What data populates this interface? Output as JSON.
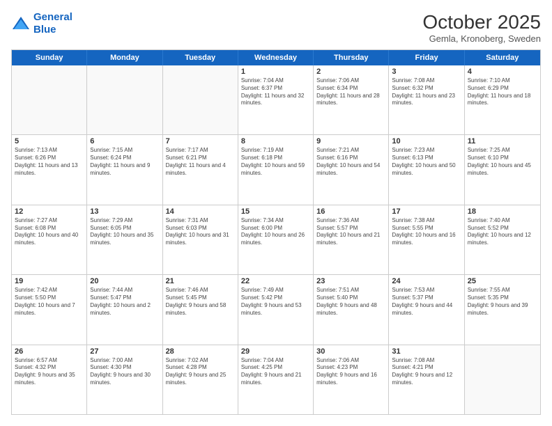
{
  "header": {
    "logo_line1": "General",
    "logo_line2": "Blue",
    "month": "October 2025",
    "location": "Gemla, Kronoberg, Sweden"
  },
  "days_of_week": [
    "Sunday",
    "Monday",
    "Tuesday",
    "Wednesday",
    "Thursday",
    "Friday",
    "Saturday"
  ],
  "weeks": [
    [
      {
        "day": "",
        "empty": true
      },
      {
        "day": "",
        "empty": true
      },
      {
        "day": "",
        "empty": true
      },
      {
        "day": "1",
        "sunrise": "7:04 AM",
        "sunset": "6:37 PM",
        "daylight": "11 hours and 32 minutes."
      },
      {
        "day": "2",
        "sunrise": "7:06 AM",
        "sunset": "6:34 PM",
        "daylight": "11 hours and 28 minutes."
      },
      {
        "day": "3",
        "sunrise": "7:08 AM",
        "sunset": "6:32 PM",
        "daylight": "11 hours and 23 minutes."
      },
      {
        "day": "4",
        "sunrise": "7:10 AM",
        "sunset": "6:29 PM",
        "daylight": "11 hours and 18 minutes."
      }
    ],
    [
      {
        "day": "5",
        "sunrise": "7:13 AM",
        "sunset": "6:26 PM",
        "daylight": "11 hours and 13 minutes."
      },
      {
        "day": "6",
        "sunrise": "7:15 AM",
        "sunset": "6:24 PM",
        "daylight": "11 hours and 9 minutes."
      },
      {
        "day": "7",
        "sunrise": "7:17 AM",
        "sunset": "6:21 PM",
        "daylight": "11 hours and 4 minutes."
      },
      {
        "day": "8",
        "sunrise": "7:19 AM",
        "sunset": "6:18 PM",
        "daylight": "10 hours and 59 minutes."
      },
      {
        "day": "9",
        "sunrise": "7:21 AM",
        "sunset": "6:16 PM",
        "daylight": "10 hours and 54 minutes."
      },
      {
        "day": "10",
        "sunrise": "7:23 AM",
        "sunset": "6:13 PM",
        "daylight": "10 hours and 50 minutes."
      },
      {
        "day": "11",
        "sunrise": "7:25 AM",
        "sunset": "6:10 PM",
        "daylight": "10 hours and 45 minutes."
      }
    ],
    [
      {
        "day": "12",
        "sunrise": "7:27 AM",
        "sunset": "6:08 PM",
        "daylight": "10 hours and 40 minutes."
      },
      {
        "day": "13",
        "sunrise": "7:29 AM",
        "sunset": "6:05 PM",
        "daylight": "10 hours and 35 minutes."
      },
      {
        "day": "14",
        "sunrise": "7:31 AM",
        "sunset": "6:03 PM",
        "daylight": "10 hours and 31 minutes."
      },
      {
        "day": "15",
        "sunrise": "7:34 AM",
        "sunset": "6:00 PM",
        "daylight": "10 hours and 26 minutes."
      },
      {
        "day": "16",
        "sunrise": "7:36 AM",
        "sunset": "5:57 PM",
        "daylight": "10 hours and 21 minutes."
      },
      {
        "day": "17",
        "sunrise": "7:38 AM",
        "sunset": "5:55 PM",
        "daylight": "10 hours and 16 minutes."
      },
      {
        "day": "18",
        "sunrise": "7:40 AM",
        "sunset": "5:52 PM",
        "daylight": "10 hours and 12 minutes."
      }
    ],
    [
      {
        "day": "19",
        "sunrise": "7:42 AM",
        "sunset": "5:50 PM",
        "daylight": "10 hours and 7 minutes."
      },
      {
        "day": "20",
        "sunrise": "7:44 AM",
        "sunset": "5:47 PM",
        "daylight": "10 hours and 2 minutes."
      },
      {
        "day": "21",
        "sunrise": "7:46 AM",
        "sunset": "5:45 PM",
        "daylight": "9 hours and 58 minutes."
      },
      {
        "day": "22",
        "sunrise": "7:49 AM",
        "sunset": "5:42 PM",
        "daylight": "9 hours and 53 minutes."
      },
      {
        "day": "23",
        "sunrise": "7:51 AM",
        "sunset": "5:40 PM",
        "daylight": "9 hours and 48 minutes."
      },
      {
        "day": "24",
        "sunrise": "7:53 AM",
        "sunset": "5:37 PM",
        "daylight": "9 hours and 44 minutes."
      },
      {
        "day": "25",
        "sunrise": "7:55 AM",
        "sunset": "5:35 PM",
        "daylight": "9 hours and 39 minutes."
      }
    ],
    [
      {
        "day": "26",
        "sunrise": "6:57 AM",
        "sunset": "4:32 PM",
        "daylight": "9 hours and 35 minutes."
      },
      {
        "day": "27",
        "sunrise": "7:00 AM",
        "sunset": "4:30 PM",
        "daylight": "9 hours and 30 minutes."
      },
      {
        "day": "28",
        "sunrise": "7:02 AM",
        "sunset": "4:28 PM",
        "daylight": "9 hours and 25 minutes."
      },
      {
        "day": "29",
        "sunrise": "7:04 AM",
        "sunset": "4:25 PM",
        "daylight": "9 hours and 21 minutes."
      },
      {
        "day": "30",
        "sunrise": "7:06 AM",
        "sunset": "4:23 PM",
        "daylight": "9 hours and 16 minutes."
      },
      {
        "day": "31",
        "sunrise": "7:08 AM",
        "sunset": "4:21 PM",
        "daylight": "9 hours and 12 minutes."
      },
      {
        "day": "",
        "empty": true
      }
    ]
  ]
}
